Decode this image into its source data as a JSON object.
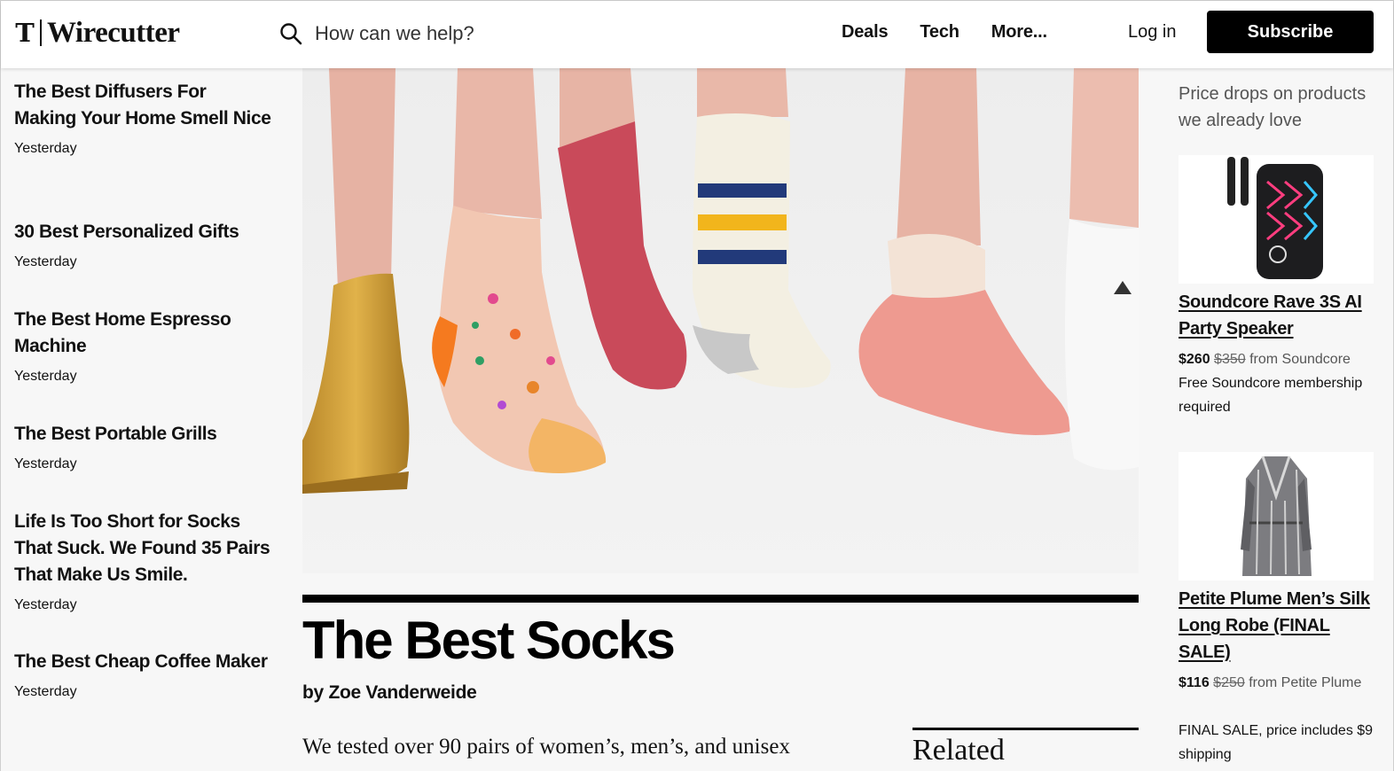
{
  "header": {
    "logo_mark": "T",
    "logo_word": "Wirecutter",
    "search_placeholder": "How can we help?",
    "nav": [
      "Deals",
      "Tech",
      "More..."
    ],
    "login": "Log in",
    "subscribe": "Subscribe"
  },
  "sidebar": {
    "items": [
      {
        "title": "The Best Diffusers For Making Your Home Smell Nice",
        "date": "Yesterday"
      },
      {
        "title": "30 Best Personalized Gifts",
        "date": "Yesterday"
      },
      {
        "title": "The Best Home Espresso Machine",
        "date": "Yesterday"
      },
      {
        "title": "The Best Portable Grills",
        "date": "Yesterday"
      },
      {
        "title": "Life Is Too Short for Socks That Suck. We Found 35 Pairs That Make Us Smile.",
        "date": "Yesterday"
      },
      {
        "title": "The Best Cheap Coffee Maker",
        "date": "Yesterday"
      }
    ]
  },
  "article": {
    "title": "The Best Socks",
    "byline": "by Zoe Vanderweide",
    "lede": "We tested over 90 pairs of women’s, men’s, and unisex",
    "related": "Related"
  },
  "deals": {
    "heading": "Price drops on products we already love",
    "cards": [
      {
        "name": "Soundcore Rave 3S AI Party Speaker",
        "price": "$260",
        "was": "$350",
        "from": "from Soundcore",
        "note": "Free Soundcore membership required"
      },
      {
        "name": "Petite Plume Men’s Silk Long Robe (FINAL SALE)",
        "price": "$116",
        "was": "$250",
        "from": "from Petite Plume",
        "note": "FINAL SALE, price includes $9 shipping"
      }
    ]
  }
}
